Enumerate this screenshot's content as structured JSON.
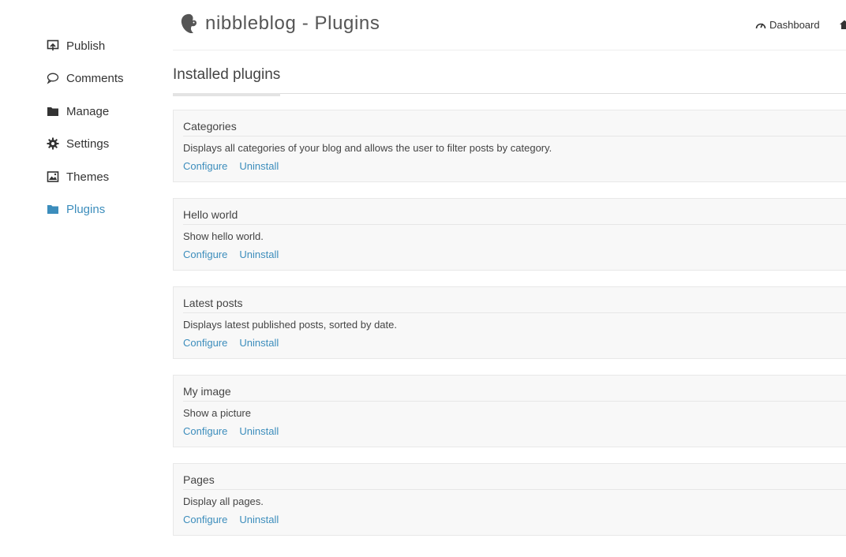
{
  "header": {
    "title": "nibbleblog - Plugins",
    "dashboard_label": "Dashboard"
  },
  "sidebar": {
    "items": [
      {
        "label": "Publish",
        "icon": "publish-icon",
        "active": false
      },
      {
        "label": "Comments",
        "icon": "comment-icon",
        "active": false
      },
      {
        "label": "Manage",
        "icon": "folder-icon",
        "active": false
      },
      {
        "label": "Settings",
        "icon": "gear-icon",
        "active": false
      },
      {
        "label": "Themes",
        "icon": "image-icon",
        "active": false
      },
      {
        "label": "Plugins",
        "icon": "folder-icon",
        "active": true
      }
    ]
  },
  "section": {
    "title": "Installed plugins"
  },
  "plugins": [
    {
      "name": "Categories",
      "description": "Displays all categories of your blog and allows the user to filter posts by category.",
      "configure_label": "Configure",
      "uninstall_label": "Uninstall"
    },
    {
      "name": "Hello world",
      "description": "Show hello world.",
      "configure_label": "Configure",
      "uninstall_label": "Uninstall"
    },
    {
      "name": "Latest posts",
      "description": "Displays latest published posts, sorted by date.",
      "configure_label": "Configure",
      "uninstall_label": "Uninstall"
    },
    {
      "name": "My image",
      "description": "Show a picture",
      "configure_label": "Configure",
      "uninstall_label": "Uninstall"
    },
    {
      "name": "Pages",
      "description": "Display all pages.",
      "configure_label": "Configure",
      "uninstall_label": "Uninstall"
    }
  ],
  "colors": {
    "accent": "#3c8dbc",
    "text": "#333333",
    "card_bg": "#f8f8f8"
  }
}
